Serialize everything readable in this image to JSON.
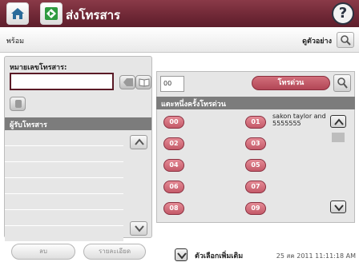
{
  "header": {
    "title": "ส่งโทรสาร",
    "help_label": "?",
    "home_icon": "home-icon",
    "start_icon": "start-icon"
  },
  "status_bar": {
    "status": "พร้อม",
    "preview_label": "ดูตัวอย่าง"
  },
  "left_panel": {
    "fax_number_label": "หมายเลขโทรสาร:",
    "fax_number_value": "",
    "recipients_header": "ผู้รับโทรสาร",
    "recipients": [
      "",
      "",
      "",
      "",
      "",
      "",
      ""
    ],
    "remove_label": "ลบ",
    "details_label": "รายละเอียด"
  },
  "right_panel": {
    "count_value": "00",
    "fax_button_label": "โทรด่วน",
    "speed_dial_header": "แตะหนึ่งครั้งโทรด่วน",
    "speed_dials": [
      "00",
      "01",
      "02",
      "03",
      "04",
      "05",
      "06",
      "07",
      "08",
      "09"
    ],
    "speed_dial_01_name": "sakon taylor and",
    "speed_dial_01_number": "5555555"
  },
  "footer": {
    "more_options_label": "ตัวเลือกเพิ่มเติม",
    "datetime": "25 สค 2011 11:11:18 AM"
  },
  "colors": {
    "header": "#6e2735",
    "accent": "#c45a69",
    "section_header": "#7c7c7c"
  }
}
